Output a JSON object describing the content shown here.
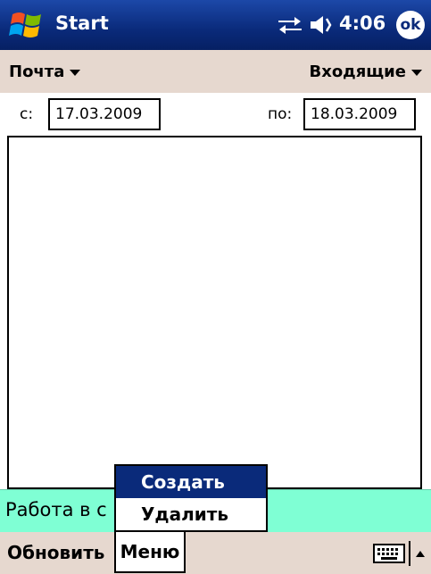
{
  "titlebar": {
    "title": "Start",
    "clock": "4:06",
    "ok_label": "ok",
    "icons": [
      "windows-start-flag-icon",
      "sync-arrows-icon",
      "volume-icon"
    ]
  },
  "menubar": {
    "left_label": "Почта",
    "right_label": "Входящие"
  },
  "filter": {
    "from_label": "с:",
    "from_value": "17.03.2009",
    "to_label": "по:",
    "to_value": "18.03.2009"
  },
  "status": {
    "text": "Работа в с"
  },
  "bottombar": {
    "left_softkey": "Обновить",
    "right_softkey": "Меню",
    "icons": [
      "keyboard-icon",
      "sip-up-arrow-icon"
    ]
  },
  "popup_menu": {
    "items": [
      "Создать",
      "Удалить"
    ],
    "selected_index": 0
  },
  "colors": {
    "titlebar": "#0a2a7a",
    "menubar": "#e6d8cf",
    "status_bar": "#7fffd4",
    "selection": "#0a2a7a"
  }
}
